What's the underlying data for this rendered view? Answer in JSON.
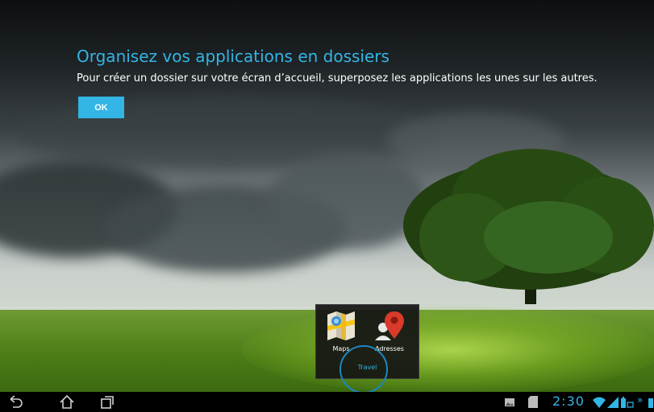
{
  "tip": {
    "title": "Organisez vos applications en dossiers",
    "body": "Pour créer un dossier sur votre écran d’accueil, superposez les applications les unes sur les autres.",
    "ok_label": "OK"
  },
  "folder": {
    "name": "Travel",
    "apps": [
      {
        "label": "Maps",
        "icon": "maps-icon"
      },
      {
        "label": "Adresses",
        "icon": "contacts-icon"
      }
    ]
  },
  "status": {
    "time": "2:30",
    "icons": [
      "gallery-icon",
      "sd-card-icon",
      "wifi-icon",
      "signal-icon",
      "battery-icon"
    ]
  },
  "nav": {
    "icons": [
      "back-icon",
      "home-icon",
      "recent-apps-icon"
    ]
  },
  "colors": {
    "accent": "#33b5e5",
    "ring": "#1c86c2"
  }
}
